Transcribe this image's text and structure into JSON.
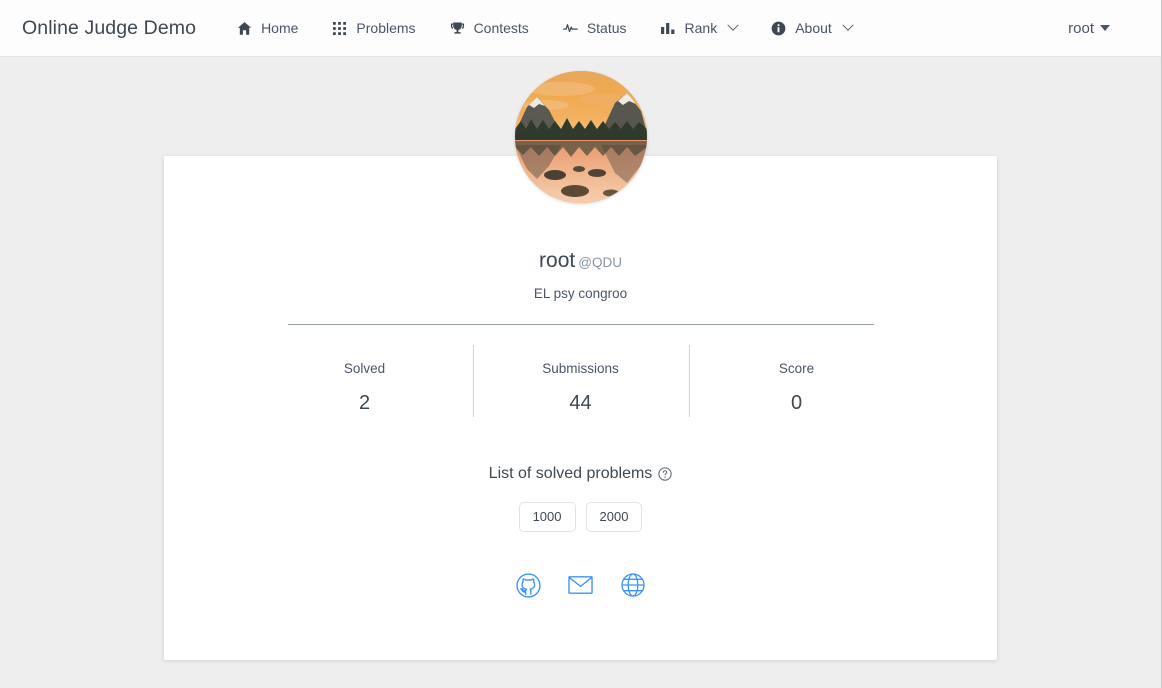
{
  "navbar": {
    "brand": "Online Judge Demo",
    "items": [
      {
        "label": "Home",
        "icon": "home-icon",
        "has_caret": false
      },
      {
        "label": "Problems",
        "icon": "grid-icon",
        "has_caret": false
      },
      {
        "label": "Contests",
        "icon": "trophy-icon",
        "has_caret": false
      },
      {
        "label": "Status",
        "icon": "pulse-icon",
        "has_caret": false
      },
      {
        "label": "Rank",
        "icon": "bar-chart-icon",
        "has_caret": true
      },
      {
        "label": "About",
        "icon": "info-icon",
        "has_caret": true
      }
    ],
    "user": {
      "name": "root",
      "caret_icon": "caret-down-icon"
    }
  },
  "profile": {
    "avatar_alt": "sunset-mountain-lake-avatar",
    "username": "root",
    "school_handle": "@QDU",
    "bio": "EL psy congroo",
    "stats": [
      {
        "label": "Solved",
        "value": "2"
      },
      {
        "label": "Submissions",
        "value": "44"
      },
      {
        "label": "Score",
        "value": "0"
      }
    ],
    "solved_section": {
      "title": "List of solved problems",
      "help_icon": "question-circle-icon",
      "problems": [
        "1000",
        "2000"
      ]
    },
    "socials": [
      {
        "name": "github-icon"
      },
      {
        "name": "mail-icon"
      },
      {
        "name": "website-globe-icon"
      }
    ]
  },
  "colors": {
    "page_background": "#eeeeee",
    "card_background": "#ffffff",
    "navbar_background": "#fdfdfd",
    "text_primary": "#3d4852",
    "text_muted": "#8795a1",
    "social_blue": "#3b93f7"
  }
}
